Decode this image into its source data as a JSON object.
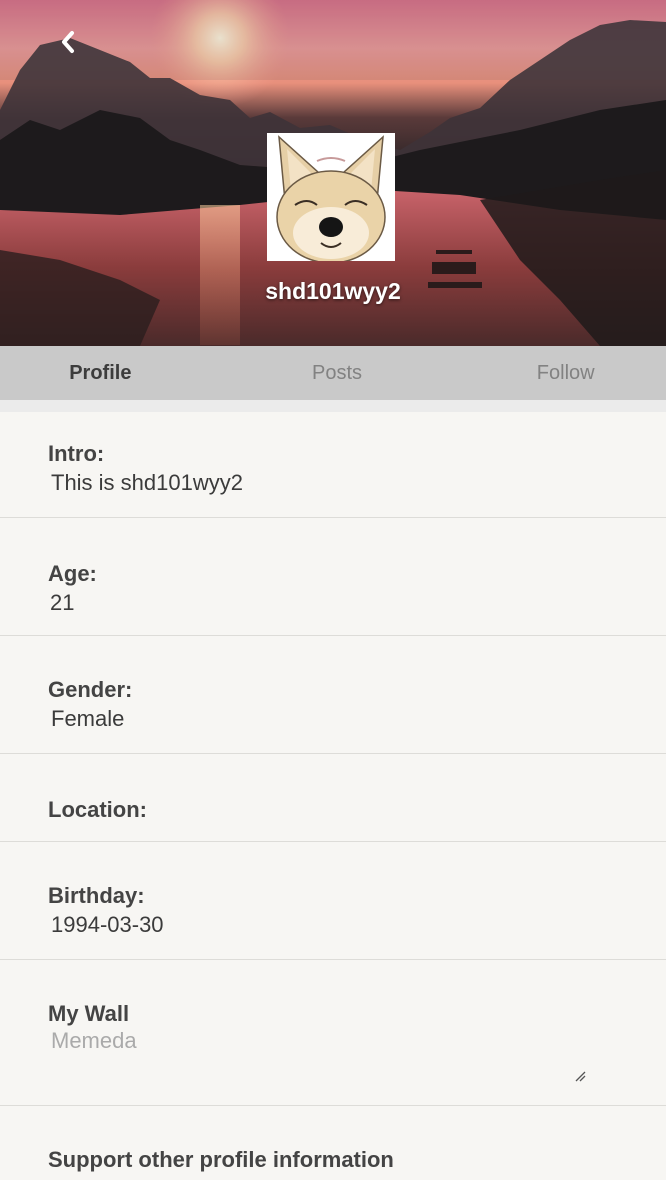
{
  "header": {
    "username": "shd101wyy2"
  },
  "tabs": [
    {
      "label": "Profile"
    },
    {
      "label": "Posts"
    },
    {
      "label": "Follow"
    }
  ],
  "profile": {
    "intro": {
      "label": "Intro:",
      "value": "This is shd101wyy2"
    },
    "age": {
      "label": "Age:",
      "value": "21"
    },
    "gender": {
      "label": "Gender:",
      "value": "Female"
    },
    "location": {
      "label": "Location:",
      "value": ""
    },
    "birthday": {
      "label": "Birthday:",
      "value": "1994-03-30"
    },
    "wall": {
      "label": "My Wall",
      "placeholder": "Memeda",
      "value": ""
    },
    "support": {
      "label": "Support other profile information"
    }
  },
  "icons": {
    "back": "chevron-left-icon",
    "avatar": "shiba-doge-avatar"
  },
  "colors": {
    "tab_active": "#3d3d3d",
    "tab_inactive": "#828282",
    "tab_bar": "#c9c9c9",
    "page_bg": "#f7f6f3"
  }
}
